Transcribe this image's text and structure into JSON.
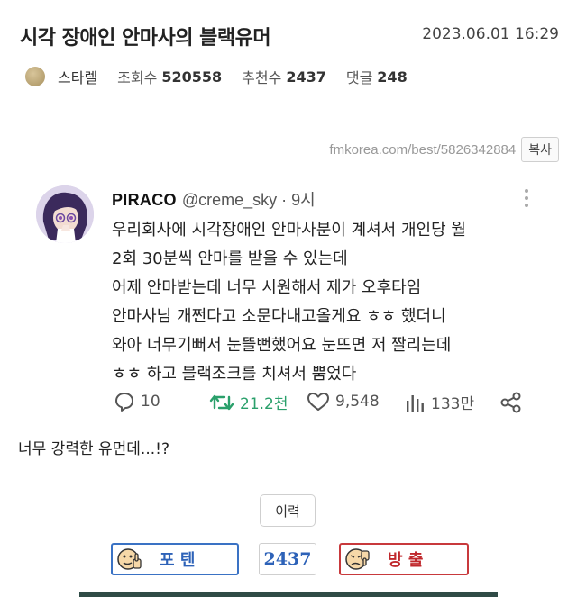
{
  "post": {
    "title": "시각 장애인 안마사의 블랙유머",
    "date": "2023.06.01 16:29",
    "author": "스타렐",
    "views_label": "조회수",
    "views": "520558",
    "likes_label": "추천수",
    "likes": "2437",
    "comments_label": "댓글",
    "comments": "248"
  },
  "url_bar": {
    "url": "fmkorea.com/best/5826342884",
    "copy_label": "복사"
  },
  "tweet": {
    "name": "PIRACO",
    "handle": "@creme_sky · 9시",
    "lines": [
      "우리회사에 시각장애인 안마사분이 계셔서 개인당 월",
      "2회 30분씩 안마를 받을 수 있는데",
      "어제 안마받는데 너무 시원해서 제가 오후타임",
      "안마사님 개쩐다고 소문다내고올게요 ㅎㅎ 했더니",
      "와아 너무기뻐서 눈뜰뻔했어요 눈뜨면 저 짤리는데",
      "ㅎㅎ 하고 블랙조크를 치셔서 뿜었다"
    ],
    "replies": "10",
    "retweets": "21.2천",
    "hearts": "9,548",
    "views": "133만",
    "icons": [
      "reply-icon",
      "retweet-icon",
      "heart-icon",
      "stats-icon",
      "share-icon"
    ]
  },
  "comment_text": "너무 강력한 유먼데...!?",
  "history_label": "이력",
  "vote": {
    "up_label": "포 텐",
    "count": "2437",
    "down_label": "방 출",
    "up_color": "#2d62b8",
    "down_color": "#c0282c"
  }
}
